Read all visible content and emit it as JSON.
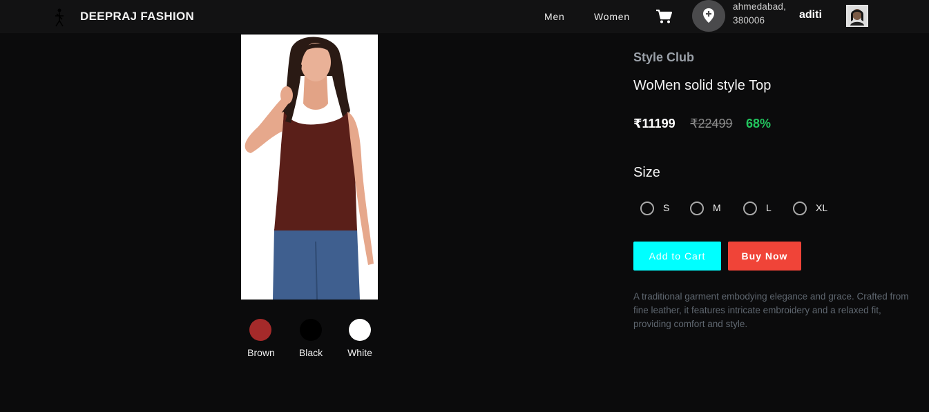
{
  "header": {
    "brand": "DEEPRAJ FASHION",
    "nav": {
      "men": "Men",
      "women": "Women"
    },
    "location_line1": "ahmedabad,",
    "location_line2": "380006",
    "username": "aditi"
  },
  "product": {
    "seller": "Style Club",
    "title": "WoMen solid style Top",
    "price": "₹11199",
    "mrp": "₹22499",
    "discount": "68%",
    "size_heading": "Size",
    "sizes": [
      "S",
      "M",
      "L",
      "XL"
    ],
    "colors": [
      {
        "label": "Brown",
        "hex": "#a52a2a"
      },
      {
        "label": "Black",
        "hex": "#000000"
      },
      {
        "label": "White",
        "hex": "#ffffff"
      }
    ],
    "add_to_cart": "Add to Cart",
    "buy_now": "Buy Now",
    "description": "A traditional garment embodying elegance and grace. Crafted from fine leather, it features intricate embroidery and a relaxed fit, providing comfort and style."
  },
  "colors": {
    "header_bg": "#121213",
    "page_bg": "#0b0b0c",
    "add_to_cart_bg": "#00ffff",
    "buy_now_bg": "#f04438",
    "discount": "#22c55e"
  },
  "icons": [
    "brand-logo-icon",
    "cart-icon",
    "location-pin-icon",
    "user-avatar"
  ]
}
